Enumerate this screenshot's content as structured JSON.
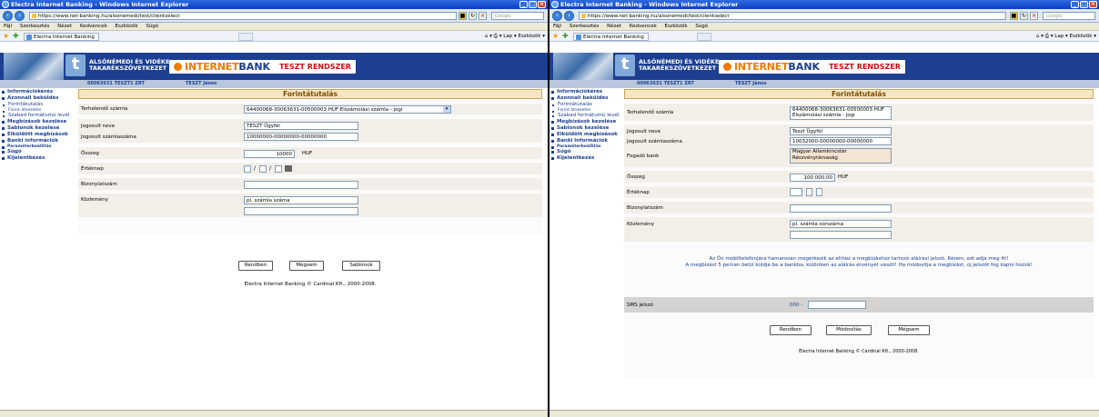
{
  "left": {
    "window_title": "Electra Internet Banking - Windows Internet Explorer",
    "url": "https://www.net-banking.hu/alsonemedi/test/clientselect",
    "search_placeholder": "Google",
    "menu": [
      "Fájl",
      "Szerkesztés",
      "Nézet",
      "Kedvencek",
      "Eszközök",
      "Súgó"
    ],
    "tab_label": "Electra Internet Banking",
    "tools": "Lap ▾  Eszközök ▾",
    "bank_name_1": "ALSÓNÉMEDI ÉS VIDÉKE",
    "bank_name_2": "TAKARÉKSZÖVETKEZET",
    "internet": "INTERNET",
    "bank": "BANK",
    "teszt_rendszer": "TESZT RENDSZER",
    "client_id": "00063631  TESZT1 ZRT",
    "client_user": "TESZT János",
    "sidebar": [
      "Információkérés",
      "Azonnali beküldés",
      "Forintátutalás",
      "Forint átvezetés",
      "Szabad formátumú levél",
      "Megbízások kezelése",
      "Sablonok kezelése",
      "Elküldött megbízások",
      "Banki információk",
      "Paraméterbeállítás",
      "Súgó",
      "Kijelentkezés"
    ],
    "form_title": "Forintátutalás",
    "labels": {
      "terhelendo": "Terhelendő számla",
      "jogosult_neve": "Jogosult neve",
      "jogosult_szamla": "Jogosult számlaszáma",
      "osszeg": "Összeg",
      "erteknap": "Értéknap",
      "bizonylat": "Bizonylatszám",
      "kozlemeny": "Közlemény"
    },
    "values": {
      "terhelendo": "64400068-30063631-00500003 HUF Elszámolási számla - jogi",
      "jogosult_neve": "TESZT Ügyfél",
      "jogosult_szamla": "10000000-00000000-00000000",
      "osszeg": "10000",
      "currency": "HUF",
      "erteknap_sep": "/",
      "kozlemeny": "pl. számla száma"
    },
    "buttons": {
      "ok": "Rendben",
      "cancel": "Mégsem",
      "template": "Sablonok"
    },
    "copyright": "Electra Internet Banking © Cardinal Kft., 2000-2008."
  },
  "right": {
    "window_title": "Electra Internet Banking - Windows Internet Explorer",
    "url": "https://www.net-banking.hu/alsonemedi/test/clientselect",
    "search_placeholder": "Google",
    "menu": [
      "Fájl",
      "Szerkesztés",
      "Nézet",
      "Kedvencek",
      "Eszközök",
      "Súgó"
    ],
    "tab_label": "Electra Internet Banking",
    "tools": "Lap ▾  Eszközök ▾",
    "bank_name_1": "ALSÓNÉMEDI ÉS VIDÉKE",
    "bank_name_2": "TAKARÉKSZÖVETKEZET",
    "internet": "INTERNET",
    "bank": "BANK",
    "teszt_rendszer": "TESZT RENDSZER",
    "client_id": "00063631  TESZT1 ZRT",
    "client_user": "TESZT János",
    "sidebar": [
      "Információkérés",
      "Azonnali beküldés",
      "Forintátutalás",
      "Forint átvezetés",
      "Szabad formátumú levél",
      "Megbízások kezelése",
      "Sablonok kezelése",
      "Elküldött megbízások",
      "Banki információk",
      "Paraméterbeállítás",
      "Súgó",
      "Kijelentkezés"
    ],
    "form_title": "Forintátutalás",
    "labels": {
      "terhelendo": "Terhelendő számla",
      "jogosult_neve": "Jogosult neve",
      "jogosult_szamla": "Jogosult számlaszáma",
      "fogado_bank": "Fogadó bank",
      "osszeg": "Összeg",
      "erteknap": "Értéknap",
      "bizonylat": "Bizonylatszám",
      "kozlemeny": "Közlemény",
      "sms": "SMS jelszó"
    },
    "values": {
      "terhelendo_1": "64400068-30063631-00500003 HUF",
      "terhelendo_2": "Elszámolási számla - jogi",
      "jogosult_neve": "Teszt Ügyfél",
      "jogosult_szamla": "10032000-00000000-00000000",
      "fogado_bank_1": "Magyar Államkincstár",
      "fogado_bank_2": "Részvénytársaság",
      "osszeg": "100 000,00",
      "currency": "HUF",
      "kozlemeny": "pl. számla sorszáma",
      "sms_prefix": "000 -"
    },
    "message_1": "Az Ön mobiltelefonjára hamarosan megérkezik az ehhez a megbízáshoz tartozó aláírási jelszó. Kérem, ezt adja meg itt!",
    "message_2": "A megbízást 5 percen belül küldje be a bankba, különben az aláírás érvényét veszti! Ha módosítja a megbízást, új jelszót fog kapni hozzá!",
    "buttons": {
      "ok": "Rendben",
      "modify": "Módosítás",
      "cancel": "Mégsem"
    },
    "copyright": "Electra Internet Banking © Cardinal Kft., 2000-2008."
  }
}
